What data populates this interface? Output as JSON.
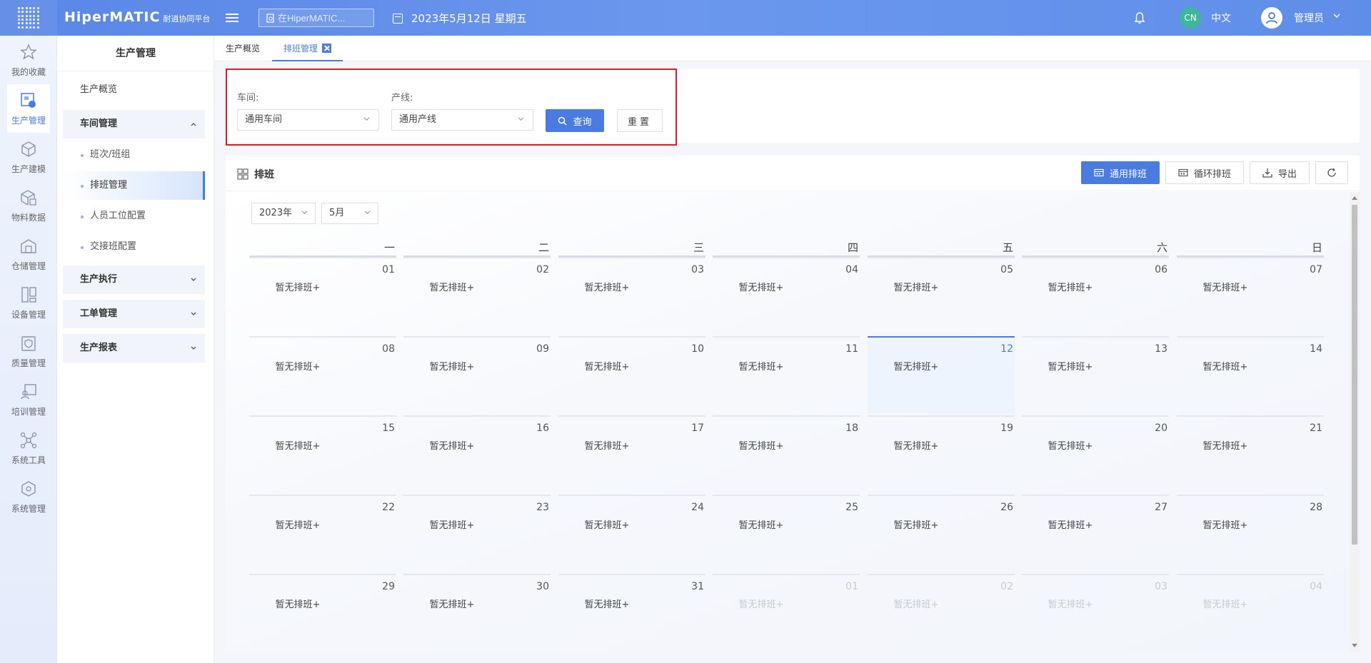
{
  "topbar": {
    "logo_main": "HiperMATIC",
    "logo_sub": "耐逍协同平台",
    "search_placeholder": "在HiperMATIC...",
    "date_text": "2023年5月12日 星期五",
    "lang_badge": "CN",
    "lang_label": "中文",
    "user_name": "管理员"
  },
  "rail": {
    "items": [
      {
        "label": "我的收藏",
        "icon": "star-icon"
      },
      {
        "label": "生产管理",
        "icon": "production-icon"
      },
      {
        "label": "生产建模",
        "icon": "cube-icon"
      },
      {
        "label": "物料数据",
        "icon": "material-icon"
      },
      {
        "label": "仓储管理",
        "icon": "warehouse-icon"
      },
      {
        "label": "设备管理",
        "icon": "device-icon"
      },
      {
        "label": "质量管理",
        "icon": "quality-icon"
      },
      {
        "label": "培训管理",
        "icon": "training-icon"
      },
      {
        "label": "系统工具",
        "icon": "network-icon"
      },
      {
        "label": "系统管理",
        "icon": "settings-cube-icon"
      }
    ]
  },
  "subnav": {
    "title": "生产管理",
    "overview": "生产概览",
    "workshop_group": "车间管理",
    "children": [
      "班次/班组",
      "排班管理",
      "人员工位配置",
      "交接班配置"
    ],
    "exec_group": "生产执行",
    "order_group": "工单管理",
    "report_group": "生产报表"
  },
  "tabs": [
    {
      "label": "生产概览"
    },
    {
      "label": "排班管理"
    }
  ],
  "filter": {
    "workshop_label": "车间:",
    "workshop_value": "通用车间",
    "line_label": "产线:",
    "line_value": "通用产线",
    "query_label": "查询",
    "reset_label": "重置"
  },
  "schedule": {
    "title": "排班",
    "btn_general": "通用排班",
    "btn_cycle": "循环排班",
    "btn_export": "导出",
    "year_value": "2023年",
    "month_value": "5月",
    "weekdays": [
      "一",
      "二",
      "三",
      "四",
      "五",
      "六",
      "日"
    ],
    "empty_text": "暂无排班+",
    "weeks": [
      [
        "01",
        "02",
        "03",
        "04",
        "05",
        "06",
        "07"
      ],
      [
        "08",
        "09",
        "10",
        "11",
        "12",
        "13",
        "14"
      ],
      [
        "15",
        "16",
        "17",
        "18",
        "19",
        "20",
        "21"
      ],
      [
        "22",
        "23",
        "24",
        "25",
        "26",
        "27",
        "28"
      ],
      [
        "29",
        "30",
        "31",
        "01",
        "02",
        "03",
        "04"
      ]
    ],
    "today": "12",
    "colors": {
      "accent": "#4a7be0",
      "highlight": "#e01b24"
    }
  }
}
